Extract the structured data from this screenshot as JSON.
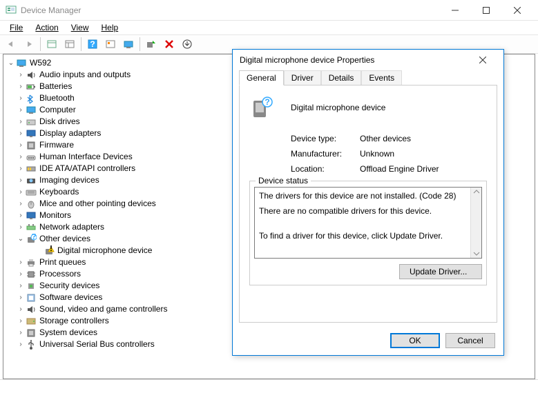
{
  "window": {
    "title": "Device Manager",
    "menu": {
      "file": "File",
      "action": "Action",
      "view": "View",
      "help": "Help"
    },
    "sysbuttons": {
      "min": "—",
      "max": "▢",
      "close": "✕"
    }
  },
  "tree": {
    "root": "W592",
    "nodes": [
      {
        "label": "Audio inputs and outputs",
        "icon": "audio"
      },
      {
        "label": "Batteries",
        "icon": "battery"
      },
      {
        "label": "Bluetooth",
        "icon": "bluetooth"
      },
      {
        "label": "Computer",
        "icon": "computer"
      },
      {
        "label": "Disk drives",
        "icon": "disk"
      },
      {
        "label": "Display adapters",
        "icon": "display"
      },
      {
        "label": "Firmware",
        "icon": "firmware"
      },
      {
        "label": "Human Interface Devices",
        "icon": "hid"
      },
      {
        "label": "IDE ATA/ATAPI controllers",
        "icon": "ide"
      },
      {
        "label": "Imaging devices",
        "icon": "imaging"
      },
      {
        "label": "Keyboards",
        "icon": "keyboard"
      },
      {
        "label": "Mice and other pointing devices",
        "icon": "mouse"
      },
      {
        "label": "Monitors",
        "icon": "monitor"
      },
      {
        "label": "Network adapters",
        "icon": "network"
      },
      {
        "label": "Other devices",
        "icon": "other",
        "expanded": true,
        "children": [
          {
            "label": "Digital microphone device",
            "icon": "warning"
          }
        ]
      },
      {
        "label": "Print queues",
        "icon": "print"
      },
      {
        "label": "Processors",
        "icon": "cpu"
      },
      {
        "label": "Security devices",
        "icon": "security"
      },
      {
        "label": "Software devices",
        "icon": "software"
      },
      {
        "label": "Sound, video and game controllers",
        "icon": "sound"
      },
      {
        "label": "Storage controllers",
        "icon": "storage"
      },
      {
        "label": "System devices",
        "icon": "system"
      },
      {
        "label": "Universal Serial Bus controllers",
        "icon": "usb"
      }
    ]
  },
  "dialog": {
    "title": "Digital microphone device Properties",
    "tabs": {
      "general": "General",
      "driver": "Driver",
      "details": "Details",
      "events": "Events"
    },
    "device_name": "Digital microphone device",
    "rows": {
      "type_label": "Device type:",
      "type_value": "Other devices",
      "mfr_label": "Manufacturer:",
      "mfr_value": "Unknown",
      "loc_label": "Location:",
      "loc_value": "Offload Engine Driver"
    },
    "status_legend": "Device status",
    "status_line1": "The drivers for this device are not installed. (Code 28)",
    "status_line2": "There are no compatible drivers for this device.",
    "status_line3": "To find a driver for this device, click Update Driver.",
    "update_btn": "Update Driver...",
    "ok": "OK",
    "cancel": "Cancel"
  }
}
